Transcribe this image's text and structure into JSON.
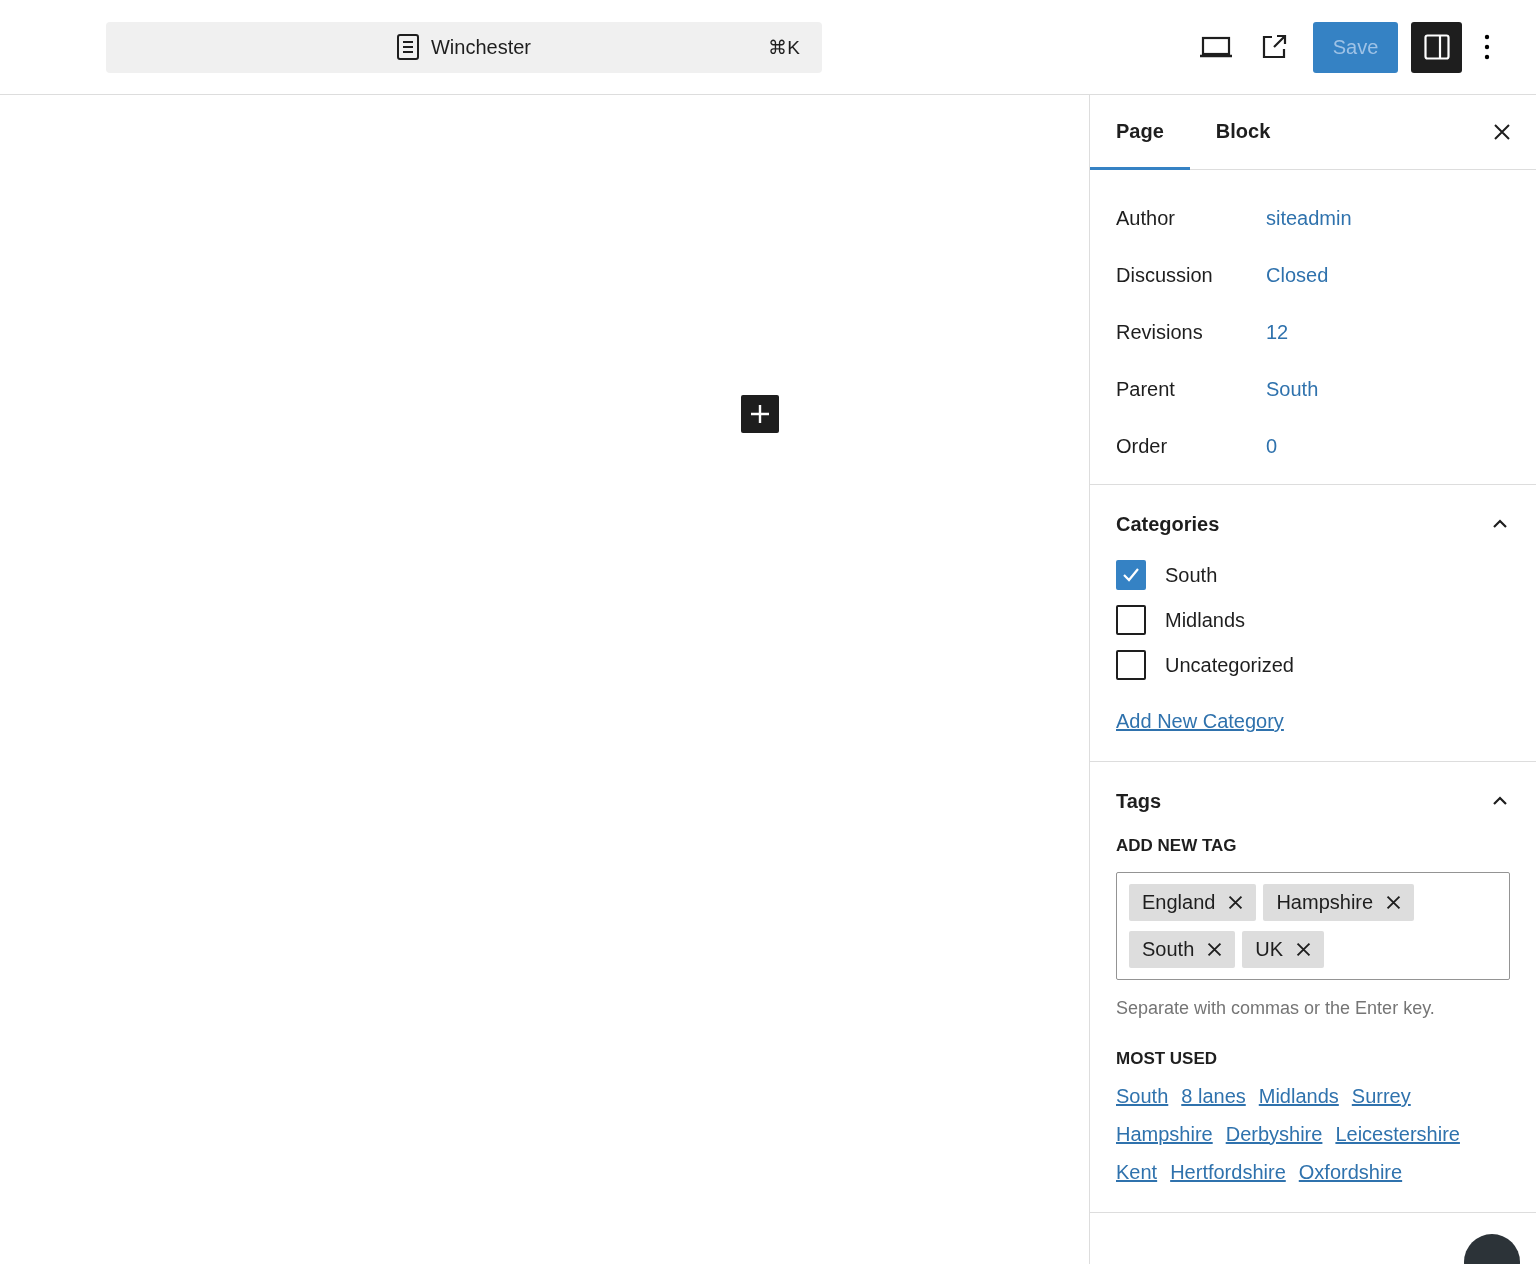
{
  "top_bar": {
    "document_title": "Winchester",
    "shortcut": "⌘K",
    "save_button": {
      "label": "Save",
      "disabled": true
    },
    "settings_toggle": {
      "on": true
    }
  },
  "sidebar": {
    "tabs": [
      {
        "label": "Page",
        "selected": true
      },
      {
        "label": "Block",
        "selected": false
      }
    ],
    "summary": [
      {
        "label": "Author",
        "value": "siteadmin"
      },
      {
        "label": "Discussion",
        "value": "Closed"
      },
      {
        "label": "Revisions",
        "value": "12"
      },
      {
        "label": "Parent",
        "value": "South"
      },
      {
        "label": "Order",
        "value": "0"
      }
    ],
    "categories": {
      "title": "Categories",
      "expanded": true,
      "items": [
        {
          "label": "South",
          "checked": true
        },
        {
          "label": "Midlands",
          "checked": false
        },
        {
          "label": "Uncategorized",
          "checked": false
        }
      ],
      "add_link": "Add New Category"
    },
    "tags": {
      "title": "Tags",
      "expanded": true,
      "field_label": "ADD NEW TAG",
      "tokens": [
        "England",
        "Hampshire",
        "South",
        "UK"
      ],
      "help": "Separate with commas or the Enter key.",
      "most_used_label": "MOST USED",
      "most_used": [
        "South",
        "8 lanes",
        "Midlands",
        "Surrey",
        "Hampshire",
        "Derbyshire",
        "Leicestershire",
        "Kent",
        "Hertfordshire",
        "Oxfordshire"
      ]
    }
  }
}
